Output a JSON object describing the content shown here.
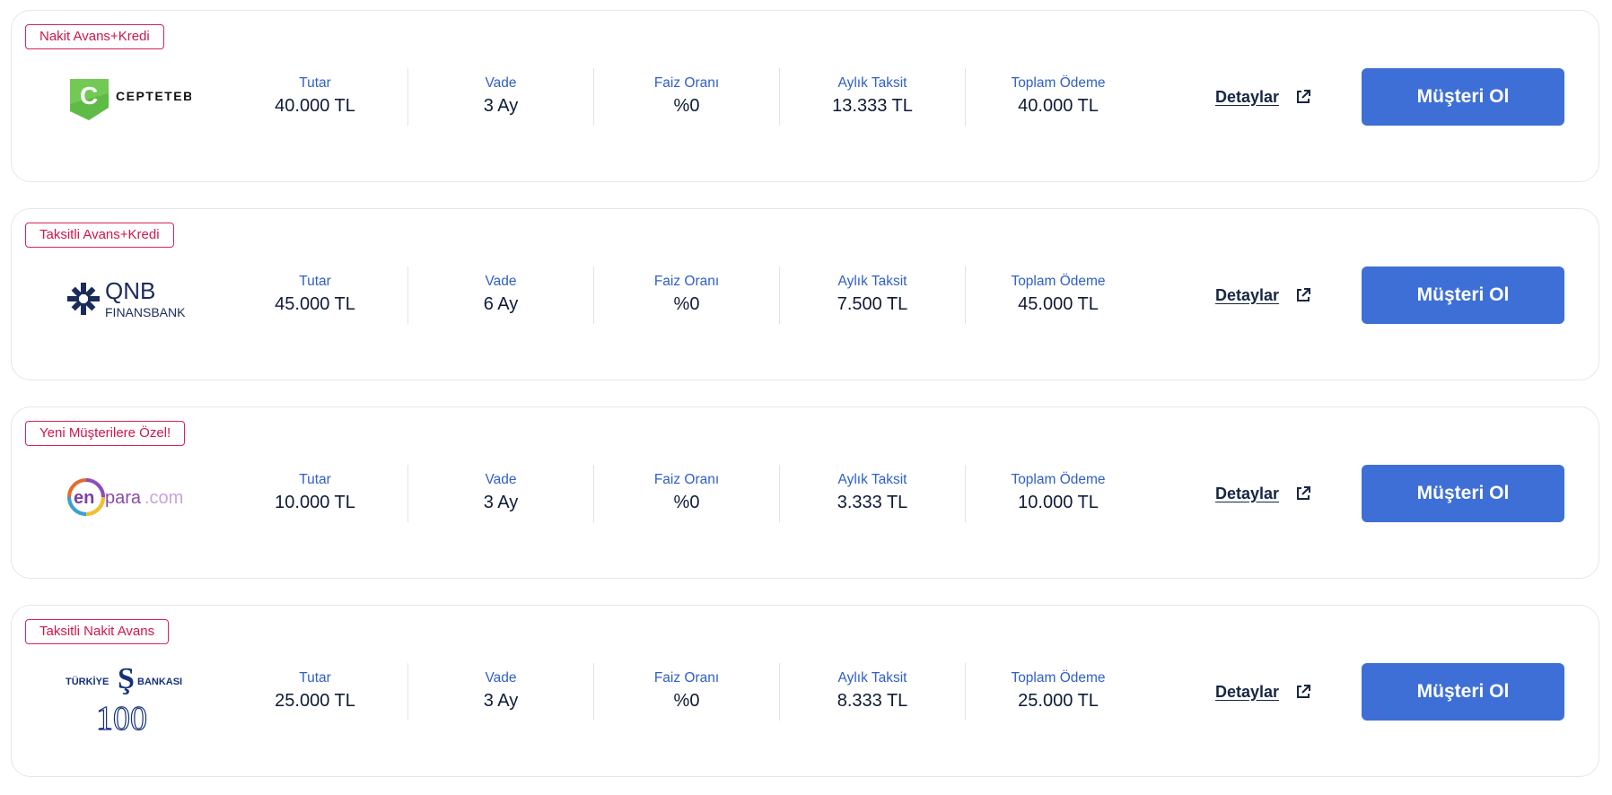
{
  "labels": {
    "amount": "Tutar",
    "term": "Vade",
    "rate": "Faiz Oranı",
    "monthly": "Aylık Taksit",
    "total": "Toplam Ödeme",
    "details": "Detaylar",
    "cta": "Müşteri Ol"
  },
  "offers": [
    {
      "badge": "Nakit Avans+Kredi",
      "bank_logo": "cepteteb-logo",
      "logo_text": "CEPTETEB",
      "amount": "40.000 TL",
      "term": "3 Ay",
      "rate": "%0",
      "monthly": "13.333 TL",
      "total": "40.000 TL"
    },
    {
      "badge": "Taksitli Avans+Kredi",
      "bank_logo": "qnb-finansbank-logo",
      "logo_text_1": "QNB",
      "logo_text_2": "FINANSBANK",
      "amount": "45.000 TL",
      "term": "6 Ay",
      "rate": "%0",
      "monthly": "7.500 TL",
      "total": "45.000 TL"
    },
    {
      "badge": "Yeni Müşterilere Özel!",
      "bank_logo": "enpara-logo",
      "logo_text_1": "en",
      "logo_text_2": "para",
      "logo_text_3": ".com",
      "amount": "10.000 TL",
      "term": "3 Ay",
      "rate": "%0",
      "monthly": "3.333 TL",
      "total": "10.000 TL"
    },
    {
      "badge": "Taksitli Nakit Avans",
      "bank_logo": "turkiye-is-bankasi-logo",
      "logo_text_1": "TÜRKİYE",
      "logo_text_2": "BANKASI",
      "logo_text_3": "100",
      "amount": "25.000 TL",
      "term": "3 Ay",
      "rate": "%0",
      "monthly": "8.333 TL",
      "total": "25.000 TL"
    }
  ],
  "colors": {
    "badge": "#d0174a",
    "label": "#2f5fc7",
    "button": "#3e6fd6",
    "value": "#0d1b35"
  }
}
